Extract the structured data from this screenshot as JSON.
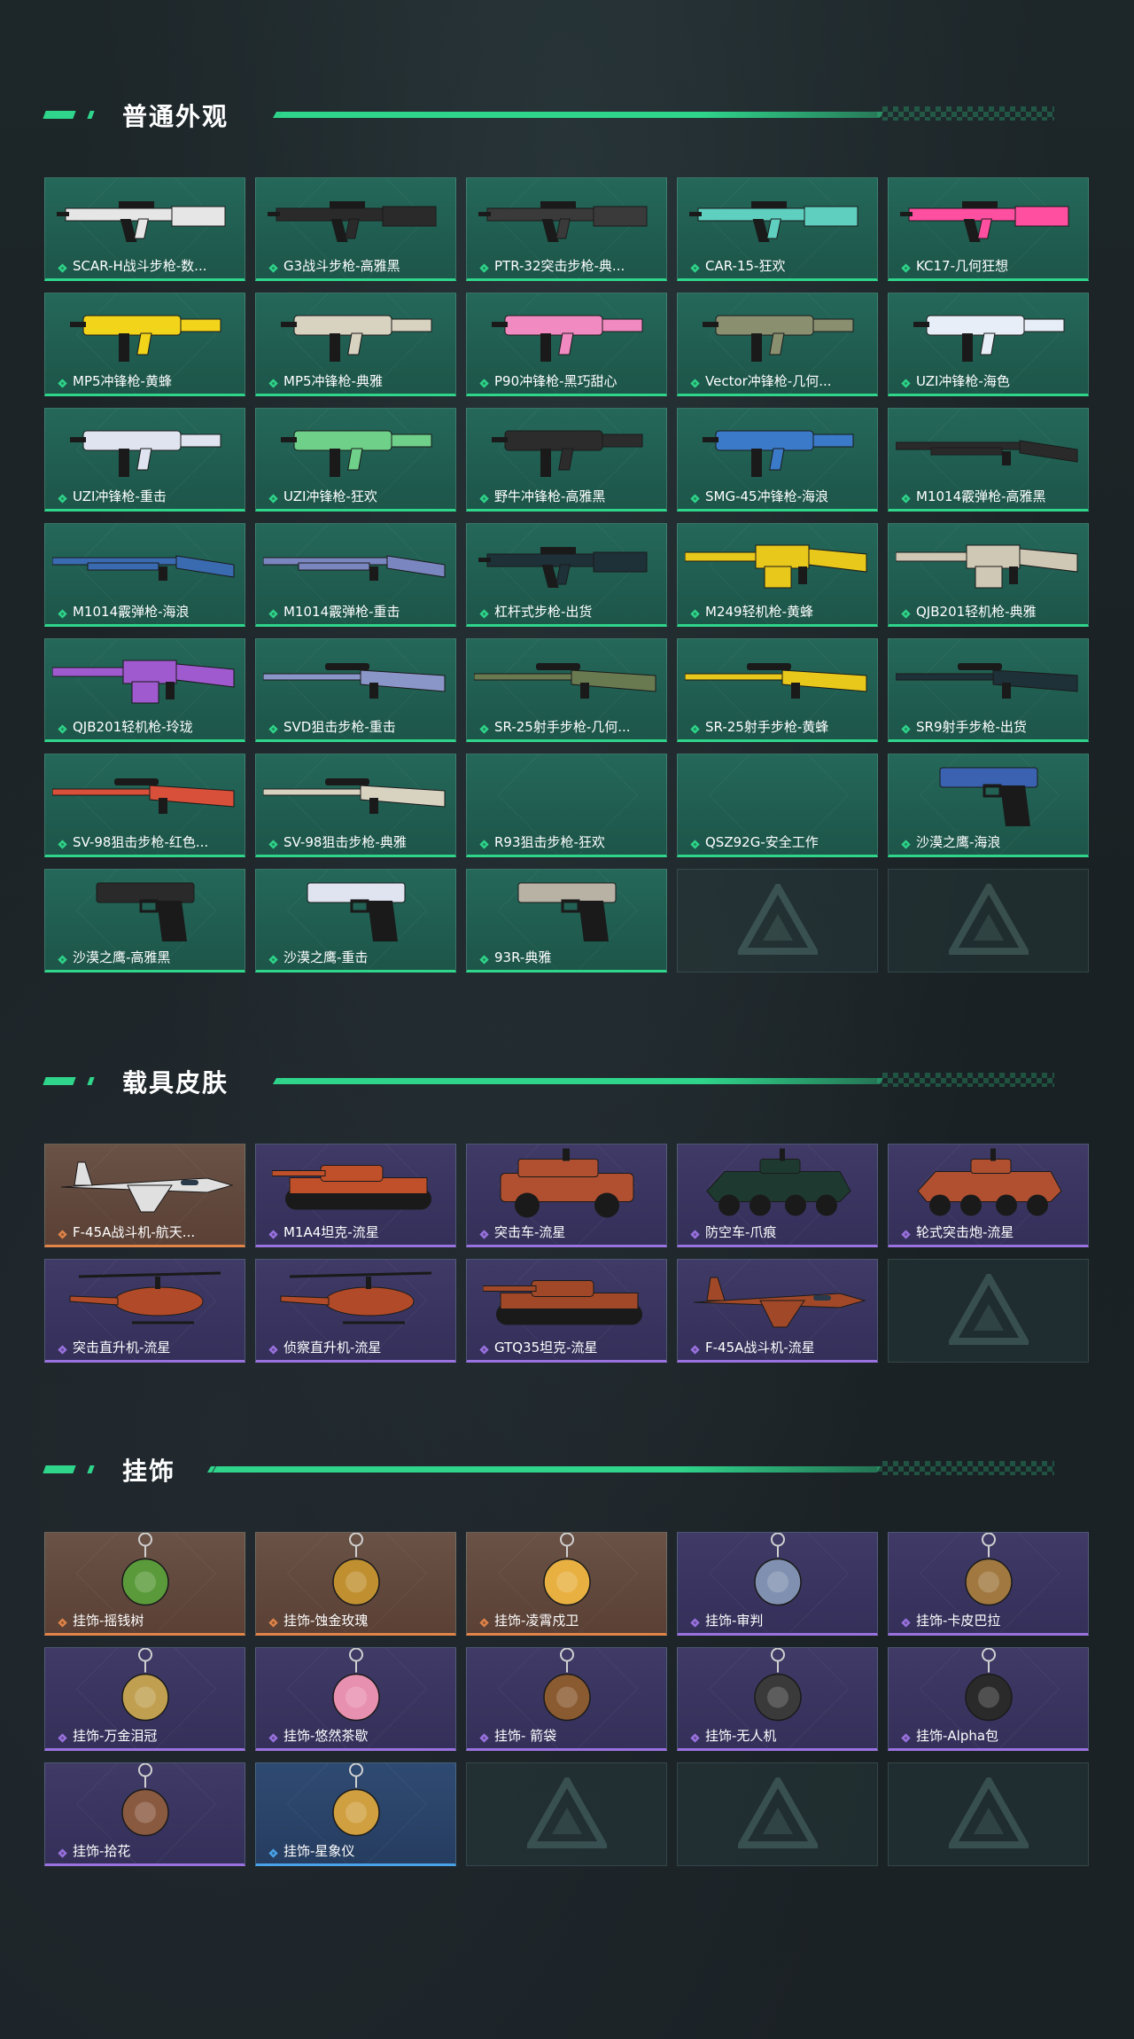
{
  "colors": {
    "accent": "#2fd58b",
    "rarity_green": "#2fd58b",
    "rarity_orange": "#e0844a",
    "rarity_purple": "#9a72e0",
    "rarity_blue": "#4aa2e8"
  },
  "sections": [
    {
      "title": "普通外观",
      "items": [
        {
          "label": "SCAR-H战斗步枪-数...",
          "rarity": "green",
          "icon": "rifle-icon",
          "tint": "#e6e6e6"
        },
        {
          "label": "G3战斗步枪-高雅黑",
          "rarity": "green",
          "icon": "rifle-icon",
          "tint": "#2a2a2a"
        },
        {
          "label": "PTR-32突击步枪-典...",
          "rarity": "green",
          "icon": "rifle-icon",
          "tint": "#3a3a3a"
        },
        {
          "label": "CAR-15-狂欢",
          "rarity": "green",
          "icon": "rifle-icon",
          "tint": "#5fd0c0"
        },
        {
          "label": "KC17-几何狂想",
          "rarity": "green",
          "icon": "rifle-icon",
          "tint": "#ff4fa0"
        },
        {
          "label": "MP5冲锋枪-黄蜂",
          "rarity": "green",
          "icon": "smg-icon",
          "tint": "#f2d41a"
        },
        {
          "label": "MP5冲锋枪-典雅",
          "rarity": "green",
          "icon": "smg-icon",
          "tint": "#d8d2c0"
        },
        {
          "label": "P90冲锋枪-黑巧甜心",
          "rarity": "green",
          "icon": "smg-icon",
          "tint": "#f28ac2"
        },
        {
          "label": "Vector冲锋枪-几何...",
          "rarity": "green",
          "icon": "smg-icon",
          "tint": "#8a8f70"
        },
        {
          "label": "UZI冲锋枪-海色",
          "rarity": "green",
          "icon": "smg-icon",
          "tint": "#e8eef8"
        },
        {
          "label": "UZI冲锋枪-重击",
          "rarity": "green",
          "icon": "smg-icon",
          "tint": "#dfe4f0"
        },
        {
          "label": "UZI冲锋枪-狂欢",
          "rarity": "green",
          "icon": "smg-icon",
          "tint": "#6fd08a"
        },
        {
          "label": "野牛冲锋枪-高雅黑",
          "rarity": "green",
          "icon": "smg-icon",
          "tint": "#2c2c2c"
        },
        {
          "label": "SMG-45冲锋枪-海浪",
          "rarity": "green",
          "icon": "smg-icon",
          "tint": "#3a7ac8"
        },
        {
          "label": "M1014霰弹枪-高雅黑",
          "rarity": "green",
          "icon": "shotgun-icon",
          "tint": "#2a2a2a"
        },
        {
          "label": "M1014霰弹枪-海浪",
          "rarity": "green",
          "icon": "shotgun-icon",
          "tint": "#3a6ab0"
        },
        {
          "label": "M1014霰弹枪-重击",
          "rarity": "green",
          "icon": "shotgun-icon",
          "tint": "#7a86c0"
        },
        {
          "label": "杠杆式步枪-出货",
          "rarity": "green",
          "icon": "rifle-icon",
          "tint": "#1e3038"
        },
        {
          "label": "M249轻机枪-黄蜂",
          "rarity": "green",
          "icon": "lmg-icon",
          "tint": "#e8c81a"
        },
        {
          "label": "QJB201轻机枪-典雅",
          "rarity": "green",
          "icon": "lmg-icon",
          "tint": "#cfc8b4"
        },
        {
          "label": "QJB201轻机枪-玲珑",
          "rarity": "green",
          "icon": "lmg-icon",
          "tint": "#a05ad0"
        },
        {
          "label": "SVD狙击步枪-重击",
          "rarity": "green",
          "icon": "sniper-icon",
          "tint": "#8a96c8"
        },
        {
          "label": "SR-25射手步枪-几何...",
          "rarity": "green",
          "icon": "sniper-icon",
          "tint": "#6a7a50"
        },
        {
          "label": "SR-25射手步枪-黄蜂",
          "rarity": "green",
          "icon": "sniper-icon",
          "tint": "#e8c81a"
        },
        {
          "label": "SR9射手步枪-出货",
          "rarity": "green",
          "icon": "sniper-icon",
          "tint": "#1e3038"
        },
        {
          "label": "SV-98狙击步枪-红色...",
          "rarity": "green",
          "icon": "sniper-icon",
          "tint": "#d8503a"
        },
        {
          "label": "SV-98狙击步枪-典雅",
          "rarity": "green",
          "icon": "sniper-icon",
          "tint": "#d8d2c0"
        },
        {
          "label": "R93狙击步枪-狂欢",
          "rarity": "green",
          "icon": "",
          "tint": ""
        },
        {
          "label": "QSZ92G-安全工作",
          "rarity": "green",
          "icon": "",
          "tint": ""
        },
        {
          "label": "沙漠之鹰-海浪",
          "rarity": "green",
          "icon": "pistol-icon",
          "tint": "#3a62b0"
        },
        {
          "label": "沙漠之鹰-高雅黑",
          "rarity": "green",
          "icon": "pistol-icon",
          "tint": "#2a2a2a"
        },
        {
          "label": "沙漠之鹰-重击",
          "rarity": "green",
          "icon": "pistol-icon",
          "tint": "#dfe4f0"
        },
        {
          "label": "93R-典雅",
          "rarity": "green",
          "icon": "pistol-icon",
          "tint": "#b8b2a4"
        },
        {
          "label": "",
          "rarity": "empty",
          "icon": "logo-placeholder-icon",
          "tint": ""
        },
        {
          "label": "",
          "rarity": "empty",
          "icon": "logo-placeholder-icon",
          "tint": ""
        }
      ]
    },
    {
      "title": "载具皮肤",
      "items": [
        {
          "label": "F-45A战斗机-航天...",
          "rarity": "orange",
          "icon": "jet-icon",
          "tint": "#e0e0e0"
        },
        {
          "label": "M1A4坦克-流星",
          "rarity": "purple",
          "icon": "tank-icon",
          "tint": "#c0502a"
        },
        {
          "label": "突击车-流星",
          "rarity": "purple",
          "icon": "jeep-icon",
          "tint": "#b05030"
        },
        {
          "label": "防空车-爪痕",
          "rarity": "purple",
          "icon": "apc-icon",
          "tint": "#1e3a30"
        },
        {
          "label": "轮式突击炮-流星",
          "rarity": "purple",
          "icon": "apc-icon",
          "tint": "#b05030"
        },
        {
          "label": "突击直升机-流星",
          "rarity": "purple",
          "icon": "helicopter-icon",
          "tint": "#b04a28"
        },
        {
          "label": "侦察直升机-流星",
          "rarity": "purple",
          "icon": "helicopter-icon",
          "tint": "#b04a28"
        },
        {
          "label": "GTQ35坦克-流星",
          "rarity": "purple",
          "icon": "tank-icon",
          "tint": "#a04828"
        },
        {
          "label": "F-45A战斗机-流星",
          "rarity": "purple",
          "icon": "jet-icon",
          "tint": "#a04828"
        },
        {
          "label": "",
          "rarity": "empty",
          "icon": "logo-placeholder-icon",
          "tint": ""
        }
      ]
    },
    {
      "title": "挂饰",
      "items": [
        {
          "label": "挂饰-摇钱树",
          "rarity": "orange",
          "icon": "charm-tree-icon",
          "tint": "#5a9a3a"
        },
        {
          "label": "挂饰-蚀金玫瑰",
          "rarity": "orange",
          "icon": "charm-rose-icon",
          "tint": "#c09030"
        },
        {
          "label": "挂饰-凌霄戍卫",
          "rarity": "orange",
          "icon": "charm-guard-icon",
          "tint": "#e8b040"
        },
        {
          "label": "挂饰-审判",
          "rarity": "purple",
          "icon": "charm-card-icon",
          "tint": "#8090b0"
        },
        {
          "label": "挂饰-卡皮巴拉",
          "rarity": "purple",
          "icon": "charm-capybara-icon",
          "tint": "#a07840"
        },
        {
          "label": "挂饰-万金泪冠",
          "rarity": "purple",
          "icon": "charm-burger-icon",
          "tint": "#c0a050"
        },
        {
          "label": "挂饰-悠然茶歇",
          "rarity": "purple",
          "icon": "charm-cupcake-icon",
          "tint": "#e890b0"
        },
        {
          "label": "挂饰- 箭袋",
          "rarity": "purple",
          "icon": "charm-quiver-icon",
          "tint": "#8a5a30"
        },
        {
          "label": "挂饰-无人机",
          "rarity": "purple",
          "icon": "charm-drone-icon",
          "tint": "#3a3a3a"
        },
        {
          "label": "挂饰-Alpha包",
          "rarity": "purple",
          "icon": "charm-bag-icon",
          "tint": "#2a2a2a"
        },
        {
          "label": "挂饰-拾花",
          "rarity": "purple",
          "icon": "charm-frame-icon",
          "tint": "#8a5a40"
        },
        {
          "label": "挂饰-星象仪",
          "rarity": "blue",
          "icon": "charm-astrolabe-icon",
          "tint": "#d0a040"
        },
        {
          "label": "",
          "rarity": "empty",
          "icon": "logo-placeholder-icon",
          "tint": ""
        },
        {
          "label": "",
          "rarity": "empty",
          "icon": "logo-placeholder-icon",
          "tint": ""
        },
        {
          "label": "",
          "rarity": "empty",
          "icon": "logo-placeholder-icon",
          "tint": ""
        }
      ]
    }
  ]
}
